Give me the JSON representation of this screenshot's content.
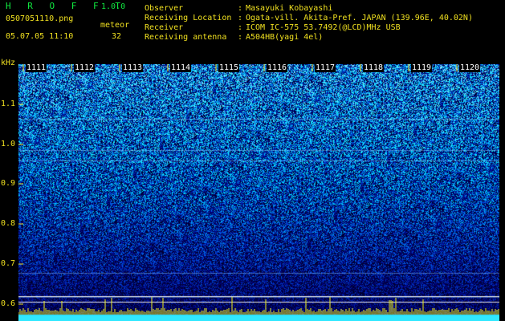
{
  "app": {
    "name": "H R O F F T",
    "version": "1.0.0"
  },
  "header": {
    "file": "0507051110.png",
    "mode": "meteor",
    "datetime": "05.07.05 11:10",
    "count": "32"
  },
  "info": [
    {
      "label": "Observer",
      "value": "Masayuki Kobayashi"
    },
    {
      "label": "Receiving Location",
      "value": "Ogata-vill. Akita-Pref. JAPAN (139.96E, 40.02N)"
    },
    {
      "label": "Receiver",
      "value": "ICOM IC-575 53.7492(@LCD)MHz USB"
    },
    {
      "label": "Receiving antenna",
      "value": "A504HB(yagi 4el)"
    }
  ],
  "axis": {
    "y_unit": "kHz",
    "y_ticks": [
      "1.1",
      "1.0",
      "0.9",
      "0.8",
      "0.7",
      "0.6"
    ],
    "x_ticks": [
      "1111",
      "1112",
      "1113",
      "1114",
      "1115",
      "1116",
      "1117",
      "1118",
      "1119",
      "1120"
    ]
  },
  "colors": {
    "text": "#f0e020",
    "title": "#10e840",
    "tick_marks": "#f0e020",
    "baseline": "#30e8ff"
  }
}
